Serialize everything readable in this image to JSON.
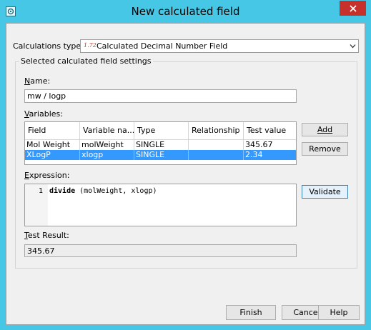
{
  "window": {
    "title": "New calculated field"
  },
  "calc_type": {
    "label": "Calculations type:",
    "icon_text": "1.72",
    "value": "Calculated Decimal Number Field"
  },
  "settings": {
    "group_title": "Selected calculated field settings",
    "name_label": "Name:",
    "name_value": "mw / logp",
    "variables_label": "Variables:",
    "columns": [
      "Field",
      "Variable na...",
      "Type",
      "Relationship",
      "Test value"
    ],
    "rows": [
      {
        "field": "Mol Weight",
        "variable": "molWeight",
        "type": "SINGLE",
        "relationship": "",
        "test_value": "345.67",
        "selected": false
      },
      {
        "field": "XLogP",
        "variable": "xlogp",
        "type": "SINGLE",
        "relationship": "",
        "test_value": "2.34",
        "selected": true
      }
    ],
    "add_label": "Add",
    "remove_label": "Remove",
    "expression_label": "Expression:",
    "expression_line_no": "1",
    "expression_keyword": "divide",
    "expression_args": " (molWeight, xlogp)",
    "validate_label": "Validate",
    "test_result_label": "Test Result:",
    "test_result_value": "345.67"
  },
  "footer": {
    "finish_label": "Finish",
    "cancel_label": "Cancel",
    "help_label": "Help"
  },
  "icons": {
    "app": "dialog-icon",
    "close": "close-icon",
    "dropdown": "chevron-down-icon"
  },
  "colors": {
    "titlebar": "#46c7e6",
    "close": "#c7312b",
    "selection": "#3399ff"
  }
}
